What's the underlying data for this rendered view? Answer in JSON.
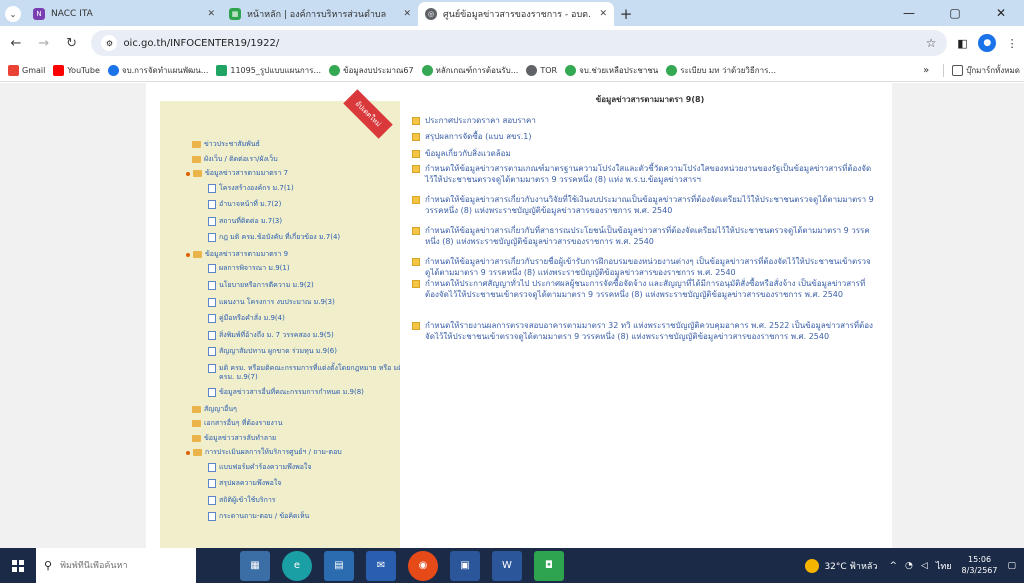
{
  "tabs": [
    {
      "label": "NACC ITA",
      "icon": "nacc-favicon",
      "active": false
    },
    {
      "label": "หน้าหลัก | องค์การบริหารส่วนตำบล",
      "icon": "oic-favicon",
      "active": false
    },
    {
      "label": "ศูนย์ข้อมูลข่าวสารของราชการ - อบต.",
      "icon": "globe-favicon",
      "active": true
    }
  ],
  "address": {
    "url": "oic.go.th/INFOCENTER19/1922/"
  },
  "bookmarks": [
    {
      "label": "Gmail",
      "color": "#ea4335"
    },
    {
      "label": "YouTube",
      "color": "#ff0000"
    },
    {
      "label": "จบ.การจัดทำแผนพัฒน...",
      "color": "#1a73e8"
    },
    {
      "label": "11095_รูปแบบแผนการ...",
      "color": "#1fa463"
    },
    {
      "label": "ข้อมูลงบประมาณ67",
      "color": "#34a853"
    },
    {
      "label": "หลักเกณฑ์การต้อนรับ...",
      "color": "#34a853"
    },
    {
      "label": "TOR",
      "color": "#5f6368"
    },
    {
      "label": "จบ.ช่วยเหลือประชาชน",
      "color": "#34a853"
    },
    {
      "label": "ระเบียบ มท ว่าด้วยวิธีการ...",
      "color": "#34a853"
    }
  ],
  "bookmarks_more": "»",
  "bookmarks_all": "บุ๊กมาร์กทั้งหมด",
  "sidebar": {
    "badge": "อัปเดตใหม่",
    "items": [
      {
        "label": "ข่าวประชาสัมพันธ์",
        "kind": "fold"
      },
      {
        "label": "ผังเว็บ / ติดต่อเรา/ผังเว็บ",
        "kind": "fold"
      },
      {
        "label": "ข้อมูลข่าวสารตามมาตรา 7",
        "kind": "fold-dot"
      },
      {
        "label": "โครงสร้างองค์กร ม.7(1)",
        "kind": "doc"
      },
      {
        "label": "อำนาจหน้าที่ ม.7(2)",
        "kind": "doc"
      },
      {
        "label": "สถานที่ติดต่อ ม.7(3)",
        "kind": "doc"
      },
      {
        "label": "กฎ มติ ครม.ข้อบังคับ ที่เกี่ยวข้อง ม.7(4)",
        "kind": "doc"
      },
      {
        "label": "ข้อมูลข่าวสารตามมาตรา 9",
        "kind": "fold-dot"
      },
      {
        "label": "ผลการพิจารณา ม.9(1)",
        "kind": "doc"
      },
      {
        "label": "นโยบายหรือการตีความ ม.9(2)",
        "kind": "doc"
      },
      {
        "label": "แผนงาน โครงการ งบประมาณ ม.9(3)",
        "kind": "doc"
      },
      {
        "label": "คู่มือหรือคำสั่ง ม.9(4)",
        "kind": "doc"
      },
      {
        "label": "สิ่งพิมพ์ที่อ้างถึง ม. 7 วรรคสอง ม.9(5)",
        "kind": "doc"
      },
      {
        "label": "สัญญาสัมปทาน ผูกขาด ร่วมทุน ม.9(6)",
        "kind": "doc"
      },
      {
        "label": "มติ ครม. หรือมติคณะกรรมการที่แต่งตั้งโดยกฎหมาย หรือ มติ ครม. ม.9(7)",
        "kind": "doc"
      },
      {
        "label": "ข้อมูลข่าวสารอื่นที่คณะกรรมการกำหนด ม.9(8)",
        "kind": "doc"
      },
      {
        "label": "สัญญาอื่นๆ",
        "kind": "fold"
      },
      {
        "label": "เอกสารอื่นๆ ที่ต้องรายงาน",
        "kind": "fold"
      },
      {
        "label": "ข้อมูลข่าวสารลับทำลาย",
        "kind": "fold"
      },
      {
        "label": "การประเมินผลการให้บริการศูนย์ฯ / ถาม-ตอบ",
        "kind": "fold-dot"
      },
      {
        "label": "แบบฟอร์มคำร้องความพึงพอใจ",
        "kind": "doc"
      },
      {
        "label": "สรุปผลความพึงพอใจ",
        "kind": "doc"
      },
      {
        "label": "สถิติผู้เข้าใช้บริการ",
        "kind": "doc"
      },
      {
        "label": "กระดานถาม-ตอบ / ข้อคิดเห็น",
        "kind": "doc"
      }
    ]
  },
  "main": {
    "header": "ข้อมูลข่าวสารตามมาตรา 9(8)",
    "items": [
      "ประกาศประกวดราคา สอบราคา",
      "สรุปผลการจัดซื้อ (แบบ สขร.1)",
      "ข้อมูลเกี่ยวกับสิ่งแวดล้อม",
      "กำหนดให้ข้อมูลข่าวสารตามเกณฑ์มาตรฐานความโปร่งใสและตัวชี้วัดความโปร่งใสของหน่วยงานของรัฐเป็นข้อมูลข่าวสารที่ต้องจัดไว้ให้ประชาชนตรวจดูได้ตามมาตรา 9 วรรคหนึ่ง (8) แห่ง พ.ร.บ.ข้อมูลข่าวสารฯ",
      "กำหนดให้ข้อมูลข่าวสารเกี่ยวกับงานวิจัยที่ใช้เงินงบประมาณเป็นข้อมูลข่าวสารที่ต้องจัดเตรียมไว้ให้ประชาชนตรวจดูได้ตามมาตรา 9 วรรคหนึ่ง (8) แห่งพระราชบัญญัติข้อมูลข่าวสารของราชการ พ.ศ. 2540",
      "กำหนดให้ข้อมูลข่าวสารเกี่ยวกับที่สาธารณประโยชน์เป็นข้อมูลข่าวสารที่ต้องจัดเตรียมไว้ให้ประชาชนตรวจดูได้ตามมาตรา 9 วรรคหนึ่ง (8) แห่งพระราชบัญญัติข้อมูลข่าวสารของราชการ พ.ศ. 2540",
      "กำหนดให้ข้อมูลข่าวสารเกี่ยวกับรายชื่อผู้เข้ารับการฝึกอบรมของหน่วยงานต่างๆ เป็นข้อมูลข่าวสารที่ต้องจัดไว้ให้ประชาชนเข้าตรวจดูได้ตามมาตรา 9 วรรคหนึ่ง (8) แห่งพระราชบัญญัติข้อมูลข่าวสารของราชการ พ.ศ. 2540",
      "กำหนดให้ประกาศสัญญาทั่วไป ประกาศผลผู้ชนะการจัดซื้อจัดจ้าง และสัญญาที่ได้มีการอนุมัติสั่งซื้อหรือสั่งจ้าง เป็นข้อมูลข่าวสารที่ต้องจัดไว้ให้ประชาชนเข้าตรวจดูได้ตามมาตรา 9 วรรคหนึ่ง (8) แห่งพระราชบัญญัติข้อมูลข่าวสารของราชการ พ.ศ. 2540",
      "กำหนดให้รายงานผลการตรวจสอบอาคารตามมาตรา 32 ทวิ แห่งพระราชบัญญัติควบคุมอาคาร พ.ศ. 2522 เป็นข้อมูลข่าวสารที่ต้องจัดไว้ให้ประชาชนเข้าตรวจดูได้ตามมาตรา 9 วรรคหนึ่ง (8) แห่งพระราชบัญญัติข้อมูลข่าวสารของราชการ พ.ศ. 2540"
    ]
  },
  "taskbar": {
    "search_placeholder": "พิมพ์ที่นี่เพื่อค้นหา",
    "weather": "32°C ฟ้าหลัว",
    "lang": "ไทย",
    "time": "15:06",
    "date": "8/3/2567"
  }
}
